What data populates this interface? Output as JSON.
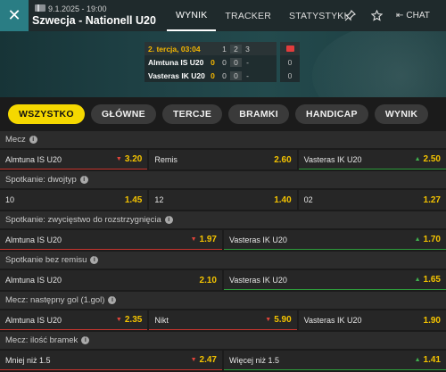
{
  "header": {
    "date": "9.1.2025 - 19:00",
    "match": "Szwecja - Nationell U20",
    "tabs": [
      "WYNIK",
      "TRACKER",
      "STATYSTYKI"
    ],
    "active_tab": "WYNIK",
    "chat_label": "CHAT"
  },
  "scoreboard": {
    "period": "2. tercja, 03:04",
    "period_cols": [
      "1",
      "2",
      "3"
    ],
    "teams": [
      {
        "name": "Almtuna IS U20",
        "score": "0",
        "periods": [
          "0",
          "0",
          "-"
        ],
        "cards": "0"
      },
      {
        "name": "Vasteras IK U20",
        "score": "0",
        "periods": [
          "0",
          "0",
          "-"
        ],
        "cards": "0"
      }
    ]
  },
  "filters": [
    "WSZYSTKO",
    "GŁÓWNE",
    "TERCJE",
    "BRAMKI",
    "HANDICAP",
    "WYNIK"
  ],
  "markets": [
    {
      "title": "Mecz",
      "rows": [
        [
          {
            "label": "Almtuna IS U20",
            "price": "3.20",
            "trend": "down"
          },
          {
            "label": "Remis",
            "price": "2.60",
            "trend": ""
          },
          {
            "label": "Vasteras IK U20",
            "price": "2.50",
            "trend": "up"
          }
        ]
      ]
    },
    {
      "title": "Spotkanie: dwojtyp",
      "rows": [
        [
          {
            "label": "10",
            "price": "1.45",
            "trend": ""
          },
          {
            "label": "12",
            "price": "1.40",
            "trend": ""
          },
          {
            "label": "02",
            "price": "1.27",
            "trend": ""
          }
        ]
      ]
    },
    {
      "title": "Spotkanie: zwycięstwo do rozstrzygnięcia",
      "rows": [
        [
          {
            "label": "Almtuna IS U20",
            "price": "1.97",
            "trend": "down"
          },
          {
            "label": "Vasteras IK U20",
            "price": "1.70",
            "trend": "up"
          }
        ]
      ]
    },
    {
      "title": "Spotkanie bez remisu",
      "rows": [
        [
          {
            "label": "Almtuna IS U20",
            "price": "2.10",
            "trend": ""
          },
          {
            "label": "Vasteras IK U20",
            "price": "1.65",
            "trend": "up"
          }
        ]
      ]
    },
    {
      "title": "Mecz: następny gol (1.gol)",
      "rows": [
        [
          {
            "label": "Almtuna IS U20",
            "price": "2.35",
            "trend": "down"
          },
          {
            "label": "Nikt",
            "price": "5.90",
            "trend": "down"
          },
          {
            "label": "Vasteras IK U20",
            "price": "1.90",
            "trend": ""
          }
        ]
      ]
    },
    {
      "title": "Mecz: ilość bramek",
      "rows": [
        [
          {
            "label": "Mniej niż 1.5",
            "price": "2.47",
            "trend": "down"
          },
          {
            "label": "Więcej niż 1.5",
            "price": "1.41",
            "trend": "up"
          }
        ]
      ]
    }
  ],
  "colors": {
    "accent": "#f5d800",
    "teal": "#2a7d84",
    "odds": "#f5c400",
    "up": "#3fb04e",
    "down": "#e0443a"
  }
}
